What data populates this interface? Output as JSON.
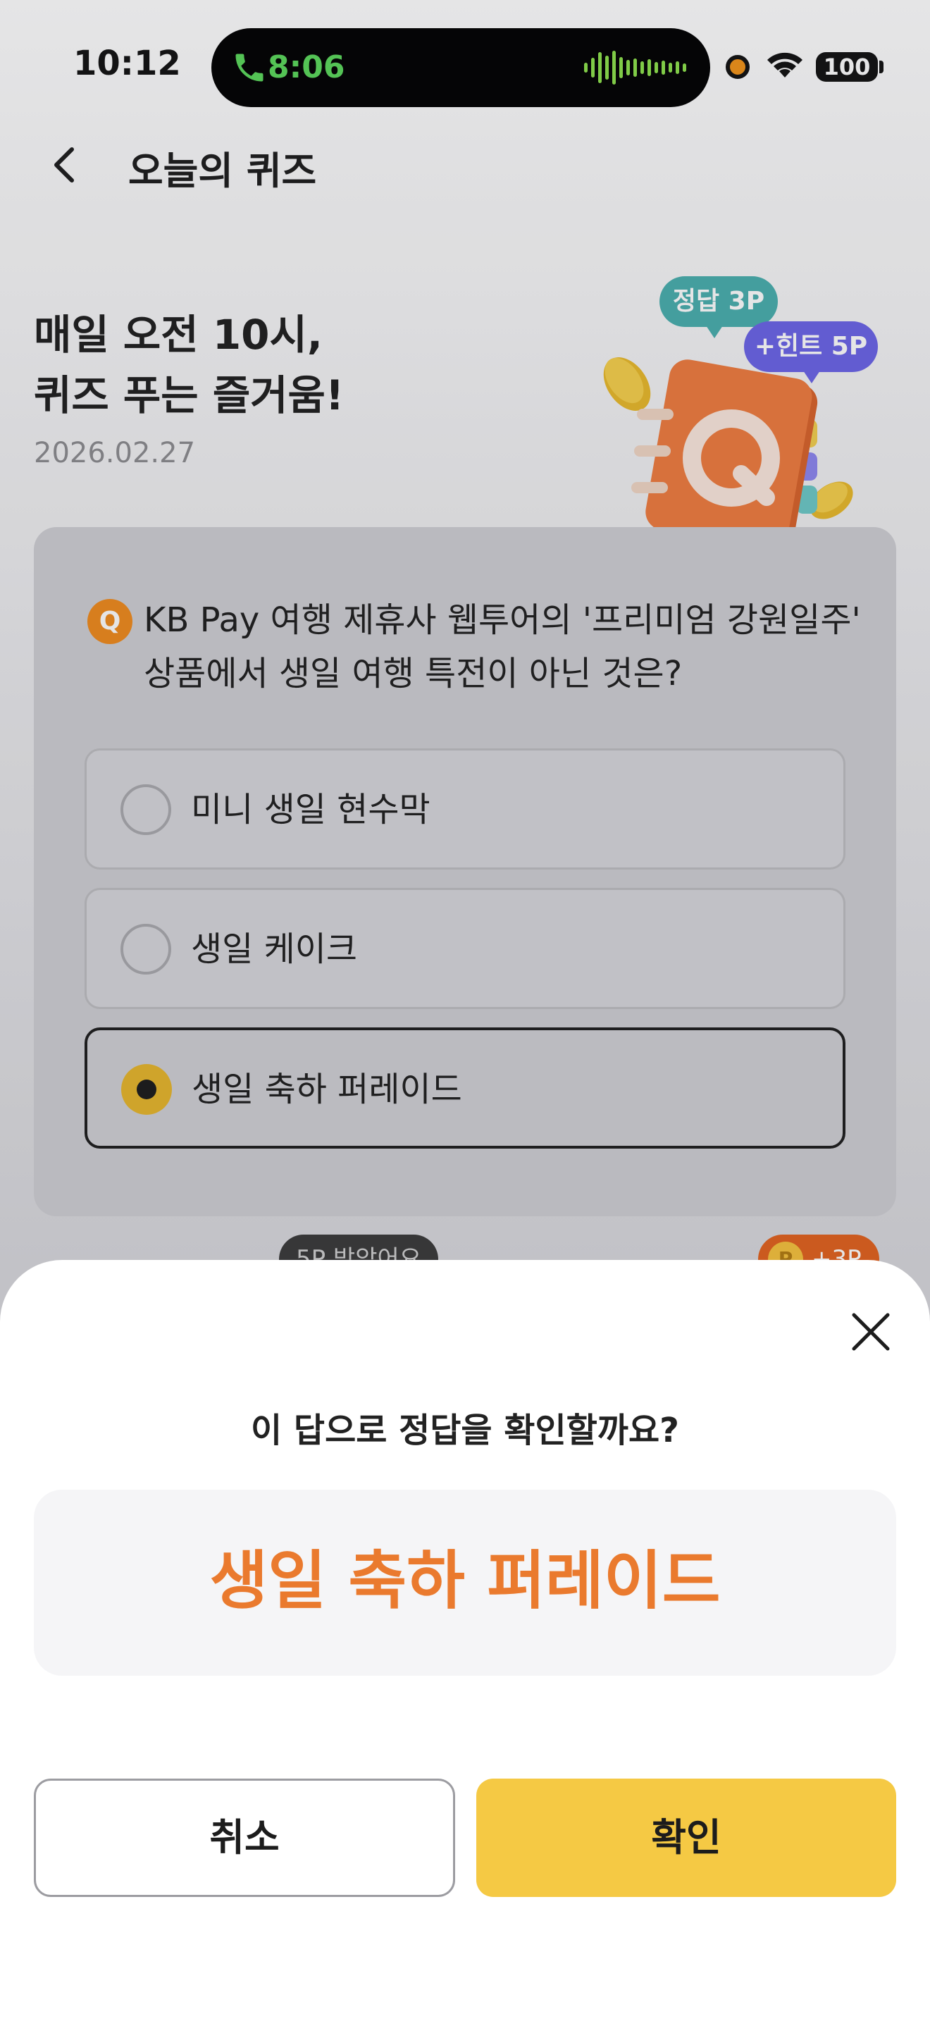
{
  "status_bar": {
    "time": "10:12",
    "call_timer": "8:06",
    "battery": "100"
  },
  "nav": {
    "title": "오늘의 퀴즈"
  },
  "hero": {
    "headline_line1": "매일 오전 10시,",
    "headline_line2": "퀴즈 푸는 즐거움!",
    "date": "2026.02.27",
    "badge_answer": "정답 3P",
    "badge_hint": "+힌트 5P"
  },
  "quiz": {
    "q_badge": "Q",
    "question": "KB Pay 여행 제휴사 웹투어의 '프리미엄 강원일주' 상품에서 생일 여행 특전이 아닌 것은?",
    "options": [
      {
        "label": "미니 생일 현수막",
        "selected": false
      },
      {
        "label": "생일 케이크",
        "selected": false
      },
      {
        "label": "생일 축하 퍼레이드",
        "selected": true
      }
    ]
  },
  "peek": {
    "pill": "5P 받았어요",
    "point": "+3P",
    "coin": "P"
  },
  "sheet": {
    "title": "이 답으로 정답을 확인할까요?",
    "answer": "생일 축하 퍼레이드",
    "cancel_label": "취소",
    "confirm_label": "확인"
  },
  "colors": {
    "accent_yellow": "#f5c944",
    "answer_orange": "#ea7a2e",
    "badge_teal": "#48afae",
    "badge_purple": "#6a63e8"
  }
}
